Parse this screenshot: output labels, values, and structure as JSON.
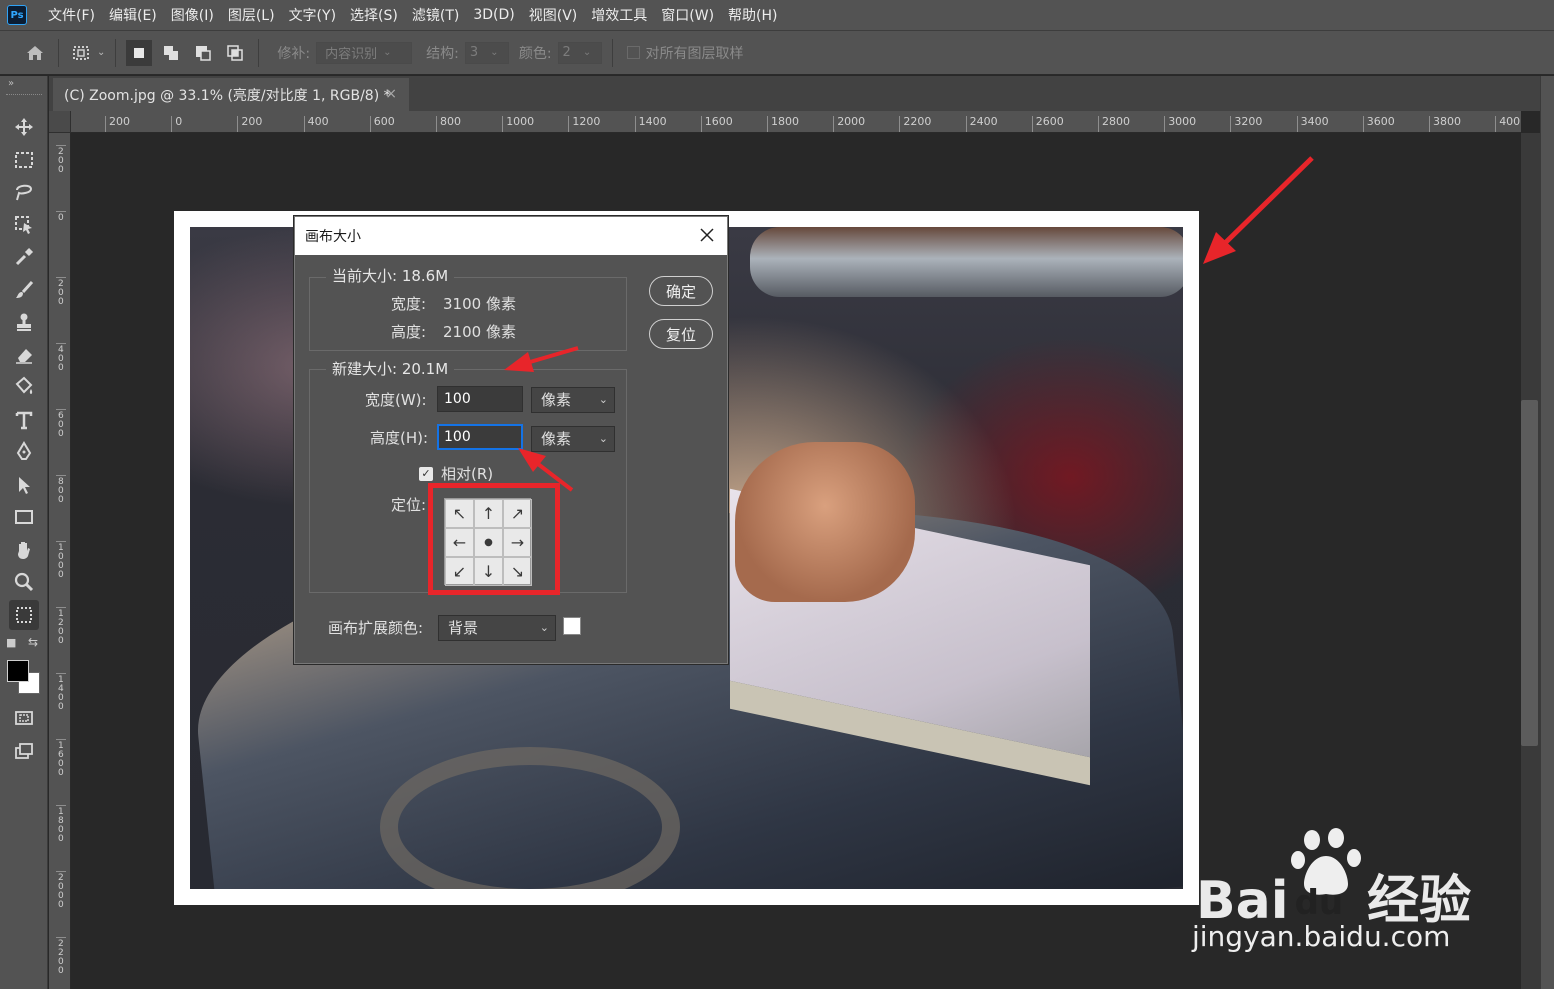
{
  "app": {
    "logo": "Ps",
    "menu": [
      "文件(F)",
      "编辑(E)",
      "图像(I)",
      "图层(L)",
      "文字(Y)",
      "选择(S)",
      "滤镜(T)",
      "3D(D)",
      "视图(V)",
      "增效工具",
      "窗口(W)",
      "帮助(H)"
    ]
  },
  "options": {
    "repair_label": "修补:",
    "repair_value": "内容识别",
    "structure_label": "结构:",
    "structure_value": "3",
    "color_label": "颜色:",
    "color_value": "2",
    "sample_all_label": "对所有图层取样"
  },
  "document": {
    "tab_title": "(C) Zoom.jpg @ 33.1% (亮度/对比度 1, RGB/8) *",
    "tab_close": "×"
  },
  "rulers": {
    "horizontal": [
      "200",
      "0",
      "200",
      "400",
      "600",
      "800",
      "1000",
      "1200",
      "1400",
      "1600",
      "1800",
      "2000",
      "2200",
      "2400",
      "2600",
      "2800",
      "3000",
      "3200",
      "3400",
      "3600",
      "3800",
      "400("
    ],
    "vertical": [
      "200",
      "0",
      "200",
      "400",
      "600",
      "800",
      "1000",
      "1200",
      "1400",
      "1600",
      "1800",
      "2000",
      "2200"
    ]
  },
  "dialog": {
    "title": "画布大小",
    "current_size_label": "当前大小: 18.6M",
    "width_label": "宽度:",
    "current_width": "3100 像素",
    "height_label": "高度:",
    "current_height": "2100 像素",
    "new_size_label": "新建大小: 20.1M",
    "new_width_label": "宽度(W):",
    "new_width_value": "100",
    "new_width_unit": "像素",
    "new_height_label": "高度(H):",
    "new_height_value": "100",
    "new_height_unit": "像素",
    "relative_label": "相对(R)",
    "relative_checked": true,
    "anchor_label": "定位:",
    "anchor_arrows": [
      "↖",
      "↑",
      "↗",
      "←",
      "●",
      "→",
      "↙",
      "↓",
      "↘"
    ],
    "extension_color_label": "画布扩展颜色:",
    "extension_color_value": "背景",
    "ok_button": "确定",
    "reset_button": "复位",
    "close_icon": "close-icon"
  },
  "watermark": {
    "logo_text": "Bai",
    "logo_text2": "du",
    "logo_suffix": "经验",
    "url": "jingyan.baidu.com"
  },
  "colors": {
    "annotation_red": "#e8252a",
    "accent_blue": "#1473e6"
  }
}
